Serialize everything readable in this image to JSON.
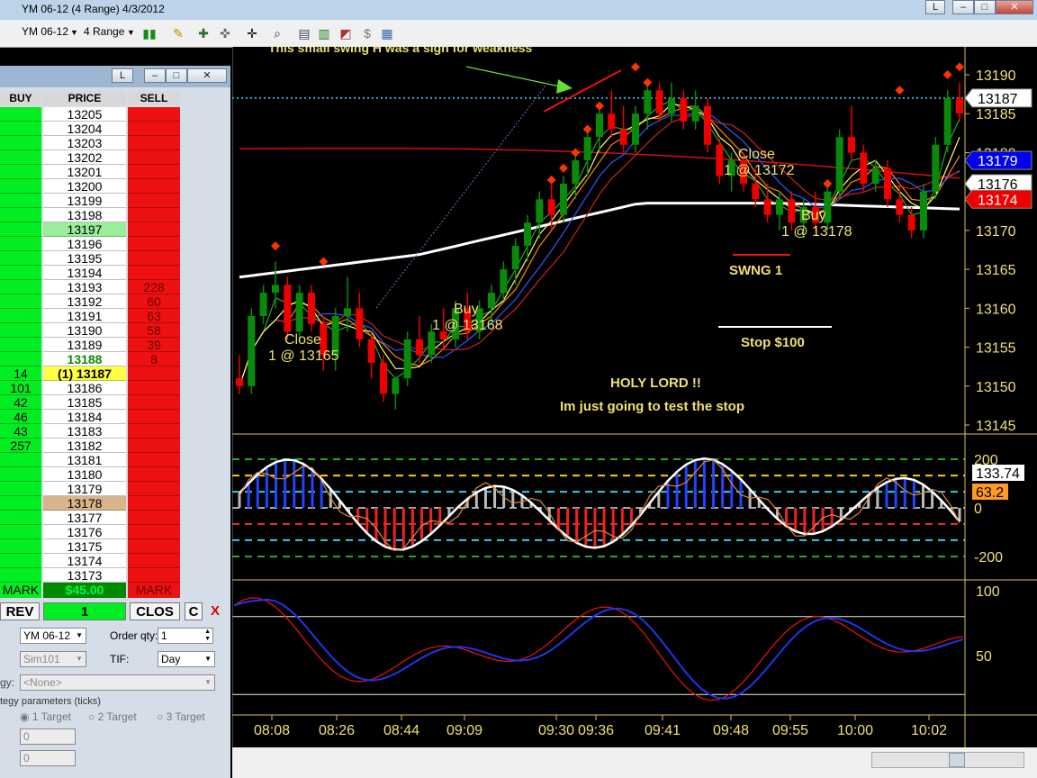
{
  "window": {
    "title": "YM 06-12 (4 Range)  4/3/2012",
    "btn_l": "L",
    "btn_min": "–",
    "btn_max": "□",
    "btn_close": "✕"
  },
  "toolbar": {
    "instrument": "YM 06-12",
    "period": "4 Range",
    "icons": [
      "bars-icon",
      "pencil-icon",
      "zoom-in-icon",
      "zoom-out-icon",
      "crosshair-icon",
      "magnifier-icon",
      "properties-icon",
      "chart-icon",
      "dollar-icon",
      "template-icon"
    ]
  },
  "dom": {
    "title_l": "L",
    "headers": {
      "buy": "BUY",
      "price": "PRICE",
      "sell": "SELL"
    },
    "rows": [
      {
        "price": "13205",
        "buy": "",
        "sell": ""
      },
      {
        "price": "13204",
        "buy": "",
        "sell": ""
      },
      {
        "price": "13203",
        "buy": "",
        "sell": ""
      },
      {
        "price": "13202",
        "buy": "",
        "sell": ""
      },
      {
        "price": "13201",
        "buy": "",
        "sell": ""
      },
      {
        "price": "13200",
        "buy": "",
        "sell": ""
      },
      {
        "price": "13199",
        "buy": "",
        "sell": ""
      },
      {
        "price": "13198",
        "buy": "",
        "sell": ""
      },
      {
        "price": "13197",
        "buy": "",
        "sell": "",
        "hl": "green"
      },
      {
        "price": "13196",
        "buy": "",
        "sell": ""
      },
      {
        "price": "13195",
        "buy": "",
        "sell": ""
      },
      {
        "price": "13194",
        "buy": "",
        "sell": ""
      },
      {
        "price": "13193",
        "buy": "",
        "sell": "228"
      },
      {
        "price": "13192",
        "buy": "",
        "sell": "60"
      },
      {
        "price": "13191",
        "buy": "",
        "sell": "63"
      },
      {
        "price": "13190",
        "buy": "",
        "sell": "58"
      },
      {
        "price": "13189",
        "buy": "",
        "sell": "39"
      },
      {
        "price": "13188",
        "buy": "",
        "sell": "8",
        "hl": "bold"
      },
      {
        "price": "(1) 13187",
        "buy": "14",
        "sell": "",
        "hl": "yellow"
      },
      {
        "price": "13186",
        "buy": "101",
        "sell": ""
      },
      {
        "price": "13185",
        "buy": "42",
        "sell": ""
      },
      {
        "price": "13184",
        "buy": "46",
        "sell": ""
      },
      {
        "price": "13183",
        "buy": "43",
        "sell": ""
      },
      {
        "price": "13182",
        "buy": "257",
        "sell": ""
      },
      {
        "price": "13181",
        "buy": "",
        "sell": ""
      },
      {
        "price": "13180",
        "buy": "",
        "sell": ""
      },
      {
        "price": "13179",
        "buy": "",
        "sell": ""
      },
      {
        "price": "13178",
        "buy": "",
        "sell": "",
        "hl": "tan"
      },
      {
        "price": "13177",
        "buy": "",
        "sell": ""
      },
      {
        "price": "13176",
        "buy": "",
        "sell": ""
      },
      {
        "price": "13175",
        "buy": "",
        "sell": ""
      },
      {
        "price": "13174",
        "buy": "",
        "sell": ""
      },
      {
        "price": "13173",
        "buy": "",
        "sell": ""
      }
    ],
    "footer": {
      "buy_mark": "MARK",
      "pnl": "$45.00",
      "sell_mark": "MARK"
    },
    "actions": {
      "rev": "REV",
      "qty": "1",
      "close": "CLOS",
      "c": "C",
      "x": "X"
    },
    "form": {
      "instrument": "YM 06-12",
      "order_qty_label": "Order qty:",
      "order_qty": "1",
      "account": "Sim101",
      "tif_label": "TIF:",
      "tif": "Day",
      "strategy_label": "gy:",
      "strategy": "<None>",
      "params_label": "tegy parameters (ticks)",
      "target1": "1 Target",
      "target2": "2 Target",
      "target3": "3 Target",
      "field1": "0",
      "field2": "0"
    }
  },
  "chart_data": {
    "type": "candlestick",
    "price_axis": {
      "ticks": [
        "13190",
        "13185",
        "13180",
        "13176",
        "13170",
        "13165",
        "13160",
        "13155",
        "13150",
        "13145"
      ],
      "ylim": [
        13143,
        13193
      ],
      "tags": [
        {
          "label": "13187",
          "value": 13187,
          "bg": "#ffffff",
          "fg": "#000000"
        },
        {
          "label": "13179",
          "value": 13179,
          "bg": "#0000ee",
          "fg": "#ffffff"
        },
        {
          "label": "13176",
          "value": 13176,
          "bg": "#ffffff",
          "fg": "#000000"
        },
        {
          "label": "13174",
          "value": 13174,
          "bg": "#ee0000",
          "fg": "#ffffff"
        }
      ]
    },
    "cci_axis": {
      "ticks": [
        "200",
        "0",
        "-200"
      ],
      "ylim": [
        -260,
        260
      ],
      "tag1": "133.74",
      "tag2": "63.2"
    },
    "stoch_axis": {
      "ticks": [
        "100",
        "50"
      ],
      "ylim": [
        0,
        110
      ]
    },
    "time_axis": [
      "08:08",
      "08:26",
      "08:44",
      "09:09",
      "09:30",
      "09:36",
      "09:41",
      "09:48",
      "09:55",
      "10:00",
      "10:02"
    ],
    "annotations": {
      "top_text": "This small swing H was a sign for weakness",
      "close1": "Close",
      "close1_fill": "1 @ 13165",
      "buy1": "Buy",
      "buy1_fill": "1 @ 13168",
      "close2": "Close",
      "close2_fill": "1 @ 13172",
      "buy2": "Buy",
      "buy2_fill": "1 @ 13178",
      "swing": "SWNG 1",
      "stop": "Stop $100",
      "holy": "HOLY LORD !!",
      "test": "Im just going to test the stop"
    },
    "candles": [
      [
        13151,
        13154,
        13149,
        13150
      ],
      [
        13150,
        13160,
        13149,
        13159
      ],
      [
        13159,
        13163,
        13158,
        13162
      ],
      [
        13162,
        13166,
        13160,
        13163
      ],
      [
        13163,
        13164,
        13156,
        13157
      ],
      [
        13157,
        13163,
        13156,
        13162
      ],
      [
        13162,
        13163,
        13157,
        13158
      ],
      [
        13158,
        13159,
        13152,
        13154
      ],
      [
        13154,
        13160,
        13152,
        13159
      ],
      [
        13159,
        13164,
        13157,
        13160
      ],
      [
        13160,
        13162,
        13155,
        13156
      ],
      [
        13156,
        13157,
        13151,
        13153
      ],
      [
        13153,
        13154,
        13148,
        13149
      ],
      [
        13149,
        13150,
        13147,
        13151
      ],
      [
        13151,
        13157,
        13150,
        13156
      ],
      [
        13156,
        13159,
        13153,
        13154
      ],
      [
        13154,
        13158,
        13153,
        13157
      ],
      [
        13157,
        13160,
        13155,
        13156
      ],
      [
        13156,
        13161,
        13155,
        13160
      ],
      [
        13160,
        13162,
        13156,
        13157
      ],
      [
        13157,
        13161,
        13156,
        13160
      ],
      [
        13160,
        13163,
        13158,
        13162
      ],
      [
        13162,
        13166,
        13161,
        13165
      ],
      [
        13165,
        13169,
        13163,
        13168
      ],
      [
        13168,
        13172,
        13166,
        13171
      ],
      [
        13171,
        13175,
        13169,
        13174
      ],
      [
        13174,
        13176,
        13170,
        13172
      ],
      [
        13172,
        13177,
        13171,
        13176
      ],
      [
        13176,
        13180,
        13174,
        13179
      ],
      [
        13179,
        13183,
        13177,
        13182
      ],
      [
        13182,
        13186,
        13180,
        13185
      ],
      [
        13185,
        13188,
        13182,
        13183
      ],
      [
        13183,
        13186,
        13180,
        13181
      ],
      [
        13181,
        13186,
        13180,
        13185
      ],
      [
        13185,
        13189,
        13183,
        13188
      ],
      [
        13188,
        13189,
        13184,
        13185
      ],
      [
        13185,
        13189,
        13184,
        13187
      ],
      [
        13187,
        13188,
        13183,
        13184
      ],
      [
        13184,
        13188,
        13183,
        13186
      ],
      [
        13186,
        13187,
        13180,
        13181
      ],
      [
        13181,
        13182,
        13176,
        13177
      ],
      [
        13177,
        13180,
        13175,
        13179
      ],
      [
        13179,
        13180,
        13175,
        13176
      ],
      [
        13176,
        13178,
        13173,
        13174
      ],
      [
        13174,
        13176,
        13171,
        13172
      ],
      [
        13172,
        13175,
        13170,
        13174
      ],
      [
        13174,
        13175,
        13170,
        13171
      ],
      [
        13171,
        13174,
        13169,
        13173
      ],
      [
        13173,
        13175,
        13170,
        13171
      ],
      [
        13171,
        13176,
        13170,
        13175
      ],
      [
        13175,
        13183,
        13174,
        13182
      ],
      [
        13182,
        13186,
        13179,
        13180
      ],
      [
        13180,
        13181,
        13175,
        13176
      ],
      [
        13176,
        13179,
        13175,
        13178
      ],
      [
        13178,
        13179,
        13173,
        13174
      ],
      [
        13174,
        13176,
        13171,
        13172
      ],
      [
        13172,
        13173,
        13169,
        13170
      ],
      [
        13170,
        13176,
        13169,
        13175
      ],
      [
        13175,
        13182,
        13174,
        13181
      ],
      [
        13181,
        13188,
        13180,
        13187
      ],
      [
        13187,
        13189,
        13184,
        13185
      ]
    ]
  }
}
